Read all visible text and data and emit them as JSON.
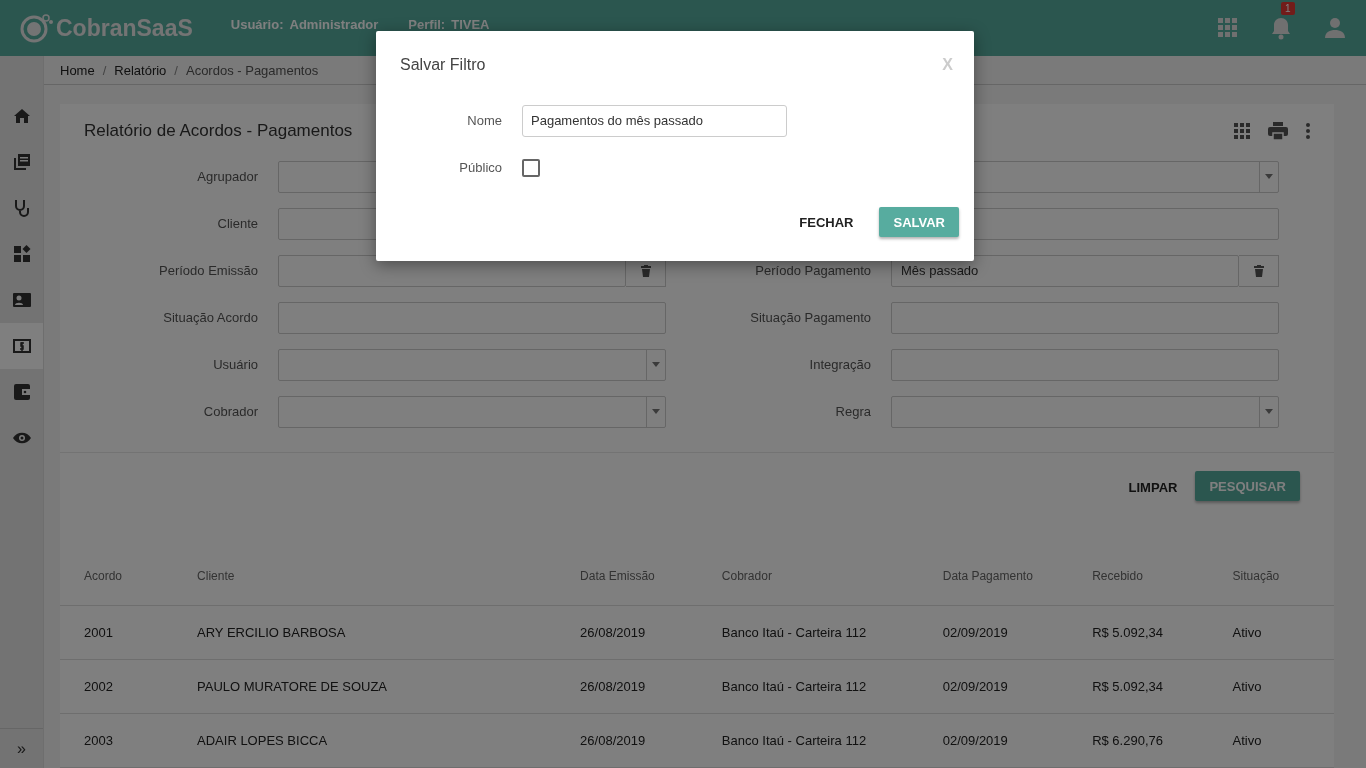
{
  "header": {
    "logo": "CobranSaaS",
    "user_label": "Usuário:",
    "user": "Administrador",
    "profile_label": "Perfil:",
    "profile": "TIVEA",
    "notification_count": "1"
  },
  "sidebar": {
    "items": [
      {
        "selected": false
      },
      {
        "selected": false
      },
      {
        "selected": false
      },
      {
        "selected": false
      },
      {
        "selected": false
      },
      {
        "selected": true
      },
      {
        "selected": false
      },
      {
        "selected": false
      }
    ],
    "expand": "»"
  },
  "breadcrumb": {
    "separator": "/",
    "items": [
      "Home",
      "Relatório",
      "Acordos - Pagamentos"
    ]
  },
  "report": {
    "title": "Relatório de Acordos - Pagamentos",
    "filters": [
      {
        "left": {
          "label": "Agrupador",
          "kind": "text"
        },
        "right": {
          "kind": "select"
        }
      },
      {
        "left": {
          "label": "Cliente",
          "kind": "text"
        },
        "right": {
          "kind": "text"
        }
      },
      {
        "left": {
          "label": "Período Emissão",
          "kind": "date"
        },
        "right": {
          "label": "Período Pagamento",
          "kind": "date",
          "value": "Mês passado"
        }
      },
      {
        "left": {
          "label": "Situação Acordo",
          "kind": "text"
        },
        "right": {
          "label": "Situação Pagamento",
          "kind": "text"
        }
      },
      {
        "left": {
          "label": "Usuário",
          "kind": "select"
        },
        "right": {
          "label": "Integração",
          "kind": "text"
        }
      },
      {
        "left": {
          "label": "Cobrador",
          "kind": "select"
        },
        "right": {
          "label": "Regra",
          "kind": "select"
        }
      }
    ],
    "buttons": {
      "clear": "LIMPAR",
      "search": "PESQUISAR"
    },
    "table": {
      "columns": [
        "Acordo",
        "Cliente",
        "Data Emissão",
        "Cobrador",
        "Data Pagamento",
        "Recebido",
        "Situação"
      ],
      "rows": [
        [
          "2001",
          "ARY ERCILIO BARBOSA",
          "26/08/2019",
          "Banco Itaú - Carteira 112",
          "02/09/2019",
          "R$ 5.092,34",
          "Ativo"
        ],
        [
          "2002",
          "PAULO MURATORE DE SOUZA",
          "26/08/2019",
          "Banco Itaú - Carteira 112",
          "02/09/2019",
          "R$ 5.092,34",
          "Ativo"
        ],
        [
          "2003",
          "ADAIR LOPES BICCA",
          "26/08/2019",
          "Banco Itaú - Carteira 112",
          "02/09/2019",
          "R$ 6.290,76",
          "Ativo"
        ]
      ]
    }
  },
  "dialog": {
    "title": "Salvar Filtro",
    "close": "X",
    "name_label": "Nome",
    "name_value": "Pagamentos do mês passado",
    "public_label": "Público",
    "public_checked": false,
    "cancel": "FECHAR",
    "save": "SALVAR"
  }
}
